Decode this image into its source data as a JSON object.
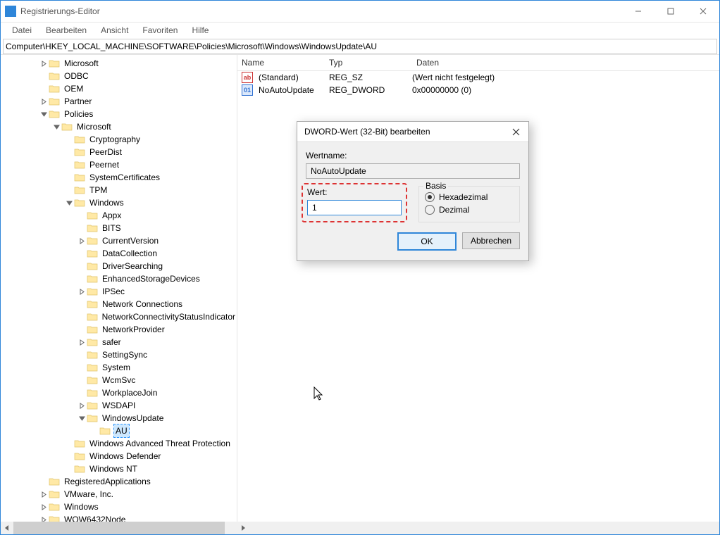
{
  "window": {
    "title": "Registrierungs-Editor"
  },
  "menu": {
    "file": "Datei",
    "edit": "Bearbeiten",
    "view": "Ansicht",
    "favorites": "Favoriten",
    "help": "Hilfe"
  },
  "address": "Computer\\HKEY_LOCAL_MACHINE\\SOFTWARE\\Policies\\Microsoft\\Windows\\WindowsUpdate\\AU",
  "tree_like": [
    {
      "indent": 3,
      "expander": "closed",
      "label": "Microsoft"
    },
    {
      "indent": 3,
      "expander": "",
      "label": "ODBC"
    },
    {
      "indent": 3,
      "expander": "",
      "label": "OEM"
    },
    {
      "indent": 3,
      "expander": "closed",
      "label": "Partner"
    },
    {
      "indent": 3,
      "expander": "open",
      "label": "Policies"
    },
    {
      "indent": 4,
      "expander": "open",
      "label": "Microsoft"
    },
    {
      "indent": 5,
      "expander": "",
      "label": "Cryptography"
    },
    {
      "indent": 5,
      "expander": "",
      "label": "PeerDist"
    },
    {
      "indent": 5,
      "expander": "",
      "label": "Peernet"
    },
    {
      "indent": 5,
      "expander": "",
      "label": "SystemCertificates"
    },
    {
      "indent": 5,
      "expander": "",
      "label": "TPM"
    },
    {
      "indent": 5,
      "expander": "open",
      "label": "Windows"
    },
    {
      "indent": 6,
      "expander": "",
      "label": "Appx"
    },
    {
      "indent": 6,
      "expander": "",
      "label": "BITS"
    },
    {
      "indent": 6,
      "expander": "closed",
      "label": "CurrentVersion"
    },
    {
      "indent": 6,
      "expander": "",
      "label": "DataCollection"
    },
    {
      "indent": 6,
      "expander": "",
      "label": "DriverSearching"
    },
    {
      "indent": 6,
      "expander": "",
      "label": "EnhancedStorageDevices"
    },
    {
      "indent": 6,
      "expander": "closed",
      "label": "IPSec"
    },
    {
      "indent": 6,
      "expander": "",
      "label": "Network Connections"
    },
    {
      "indent": 6,
      "expander": "",
      "label": "NetworkConnectivityStatusIndicator"
    },
    {
      "indent": 6,
      "expander": "",
      "label": "NetworkProvider"
    },
    {
      "indent": 6,
      "expander": "closed",
      "label": "safer"
    },
    {
      "indent": 6,
      "expander": "",
      "label": "SettingSync"
    },
    {
      "indent": 6,
      "expander": "",
      "label": "System"
    },
    {
      "indent": 6,
      "expander": "",
      "label": "WcmSvc"
    },
    {
      "indent": 6,
      "expander": "",
      "label": "WorkplaceJoin"
    },
    {
      "indent": 6,
      "expander": "closed",
      "label": "WSDAPI"
    },
    {
      "indent": 6,
      "expander": "open",
      "label": "WindowsUpdate"
    },
    {
      "indent": 7,
      "expander": "",
      "label": "AU",
      "selected": true
    },
    {
      "indent": 5,
      "expander": "",
      "label": "Windows Advanced Threat Protection"
    },
    {
      "indent": 5,
      "expander": "",
      "label": "Windows Defender"
    },
    {
      "indent": 5,
      "expander": "",
      "label": "Windows NT"
    },
    {
      "indent": 3,
      "expander": "",
      "label": "RegisteredApplications"
    },
    {
      "indent": 3,
      "expander": "closed",
      "label": "VMware, Inc."
    },
    {
      "indent": 3,
      "expander": "closed",
      "label": "Windows"
    },
    {
      "indent": 3,
      "expander": "closed",
      "label": "WOW6432Node"
    }
  ],
  "list": {
    "columns": {
      "name": "Name",
      "type": "Typ",
      "data": "Daten"
    },
    "rows": [
      {
        "icon": "sz",
        "name": "(Standard)",
        "type": "REG_SZ",
        "data": "(Wert nicht festgelegt)"
      },
      {
        "icon": "dw",
        "name": "NoAutoUpdate",
        "type": "REG_DWORD",
        "data": "0x00000000 (0)"
      }
    ]
  },
  "dialog": {
    "title": "DWORD-Wert (32-Bit) bearbeiten",
    "name_label": "Wertname:",
    "name_value": "NoAutoUpdate",
    "value_label": "Wert:",
    "value_value": "1",
    "basis_label": "Basis",
    "radio_hex": "Hexadezimal",
    "radio_dec": "Dezimal",
    "radio_selected": "hex",
    "ok": "OK",
    "cancel": "Abbrechen"
  }
}
